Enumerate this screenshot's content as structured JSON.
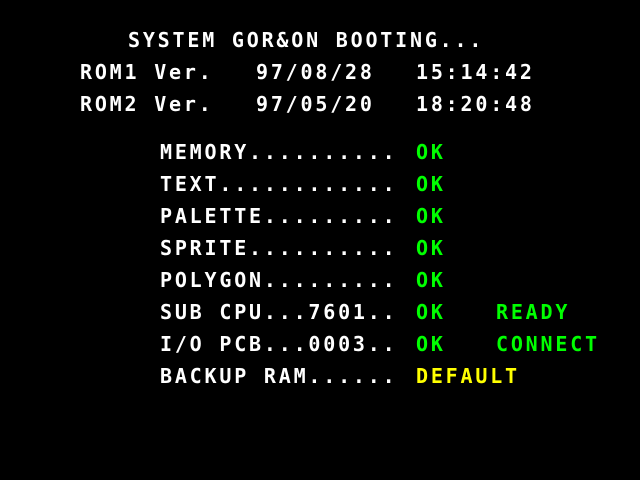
{
  "colors": {
    "background": "#000000",
    "text": "#ffffff",
    "ok": "#00ff00",
    "warning": "#ffff00"
  },
  "header": {
    "title": "SYSTEM GOR&ON BOOTING...",
    "rom1_label": "ROM1 Ver.",
    "rom1_date": "97/08/28",
    "rom1_time": "15:14:42",
    "rom2_label": "ROM2 Ver.",
    "rom2_date": "97/05/20",
    "rom2_time": "18:20:48"
  },
  "checks": [
    {
      "label": "MEMORY..........",
      "status": "OK",
      "extra": ""
    },
    {
      "label": "TEXT............",
      "status": "OK",
      "extra": ""
    },
    {
      "label": "PALETTE.........",
      "status": "OK",
      "extra": ""
    },
    {
      "label": "SPRITE..........",
      "status": "OK",
      "extra": ""
    },
    {
      "label": "POLYGON.........",
      "status": "OK",
      "extra": ""
    },
    {
      "label": "SUB CPU...7601..",
      "status": "OK",
      "extra": "READY"
    },
    {
      "label": "I/O PCB...0003..",
      "status": "OK",
      "extra": "CONNECT"
    },
    {
      "label": "BACKUP RAM......",
      "status": "DEFAULT",
      "extra": ""
    }
  ]
}
